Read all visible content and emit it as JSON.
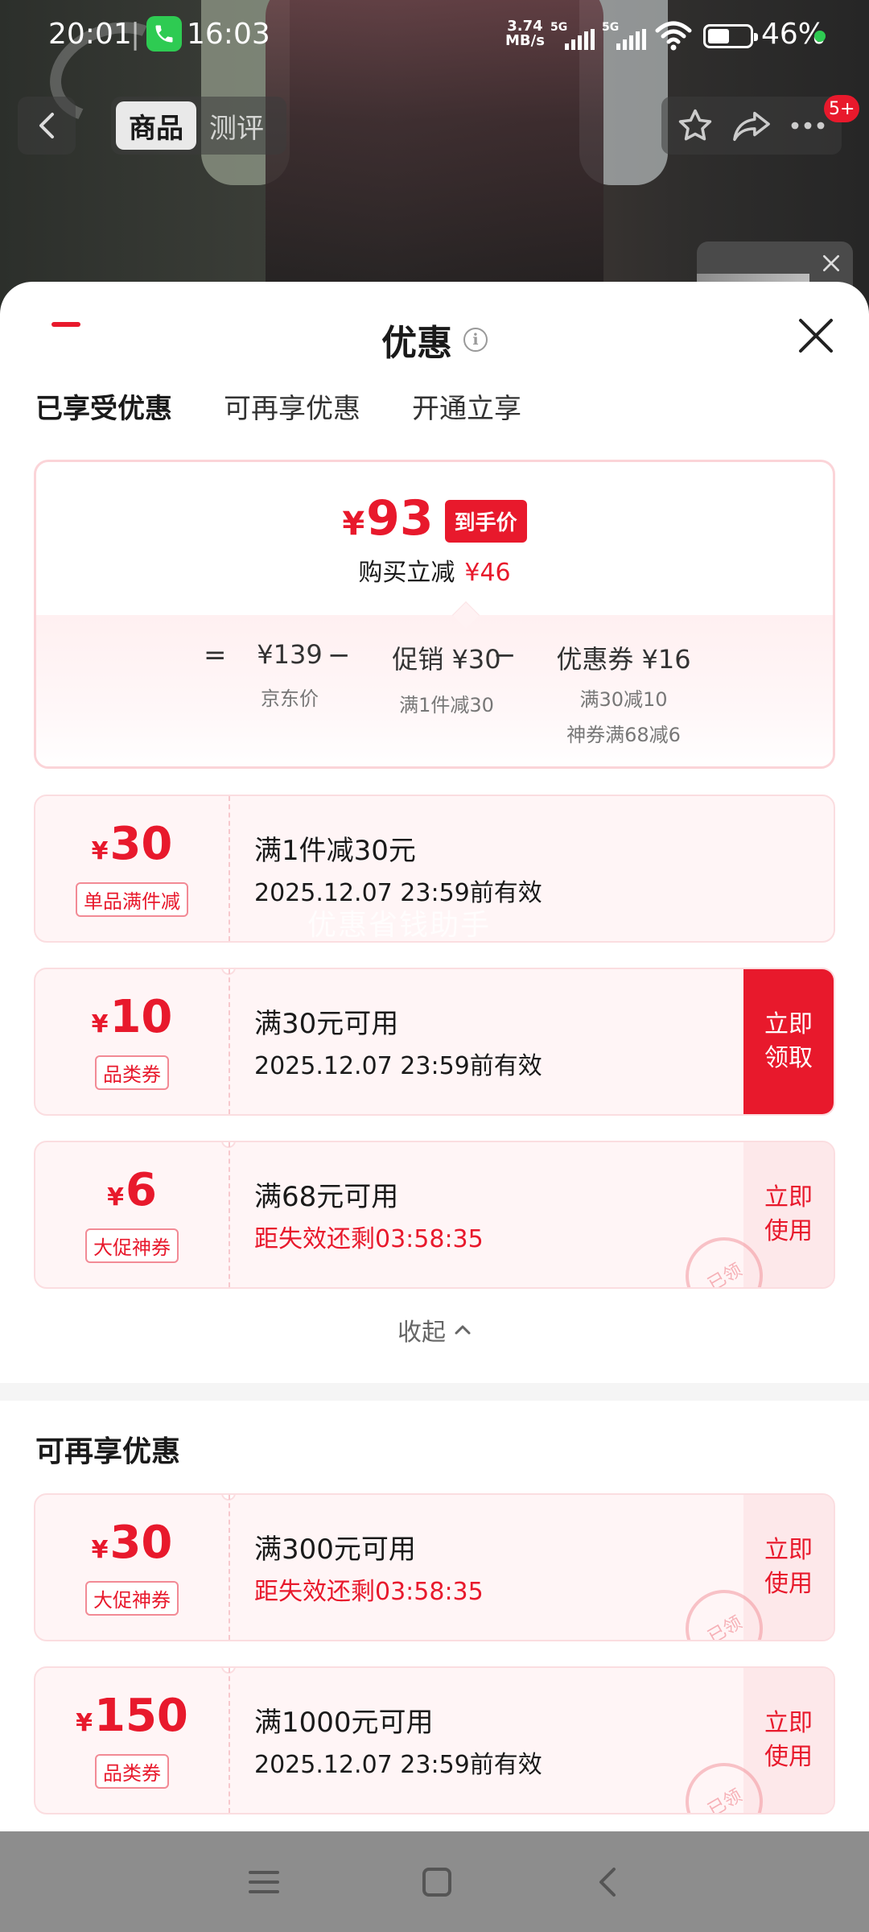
{
  "status_bar": {
    "time": "20:01",
    "separator": "|",
    "call_time": "16:03",
    "net_speed_value": "3.74",
    "net_speed_unit": "MB/s",
    "sim1": "5G",
    "sim2": "5G",
    "battery_pct": "46%",
    "battery_level": 0.46
  },
  "top_nav": {
    "tabs": [
      {
        "label": "商品",
        "active": true
      },
      {
        "label": "测评",
        "active": false
      }
    ],
    "notification_badge": "5+"
  },
  "sheet": {
    "title": "优惠",
    "tabs": [
      {
        "label": "已享受优惠",
        "active": true
      },
      {
        "label": "可再享优惠",
        "active": false
      },
      {
        "label": "开通立享",
        "active": false
      }
    ],
    "summary": {
      "currency": "¥",
      "final_price": "93",
      "final_price_tag": "到手价",
      "reduce_label": "购买立减",
      "reduce_value": "¥46",
      "formula": {
        "eq": "=",
        "op1": "−",
        "op2": "−",
        "item1_main": "¥139",
        "item1_sub": "京东价",
        "item2_main": "促销 ¥30",
        "item2_sub": "满1件减30",
        "item3_main": "优惠券 ¥16",
        "item3_sub1": "满30减10",
        "item3_sub2": "神券满68减6"
      }
    },
    "enjoyed_coupons": [
      {
        "currency": "¥",
        "amount": "30",
        "type": "单品满件减",
        "title": "满1件减30元",
        "desc": "2025.12.07 23:59前有效",
        "desc_red": false,
        "action": ""
      },
      {
        "currency": "¥",
        "amount": "10",
        "type": "品类券",
        "title": "满30元可用",
        "desc": "2025.12.07 23:59前有效",
        "desc_red": false,
        "action": "立即\n领取"
      },
      {
        "currency": "¥",
        "amount": "6",
        "type": "大促神券",
        "title": "满68元可用",
        "desc": "距失效还剩03:58:35",
        "desc_red": true,
        "action": "立即\n使用",
        "stamp": "已领"
      }
    ],
    "watermark": "优惠省钱助手",
    "collapse_label": "收起",
    "more_section_title": "可再享优惠",
    "more_coupons": [
      {
        "currency": "¥",
        "amount": "30",
        "type": "大促神券",
        "title": "满300元可用",
        "desc": "距失效还剩03:58:35",
        "desc_red": true,
        "action": "立即\n使用",
        "stamp": "已领"
      },
      {
        "currency": "¥",
        "amount": "150",
        "type": "品类券",
        "title": "满1000元可用",
        "desc": "2025.12.07 23:59前有效",
        "desc_red": false,
        "action": "立即\n使用",
        "stamp": "已领"
      }
    ]
  },
  "colors": {
    "accent": "#e8192c",
    "coupon_bg": "#fff5f6",
    "navbar_bg": "#8d8d8d"
  },
  "icons": [
    "back-icon",
    "star-icon",
    "share-icon",
    "more-icon",
    "close-icon",
    "info-icon",
    "chevron-up-icon",
    "menu-icon",
    "home-icon",
    "back-nav-icon",
    "phone-icon",
    "wifi-icon",
    "battery-icon"
  ]
}
